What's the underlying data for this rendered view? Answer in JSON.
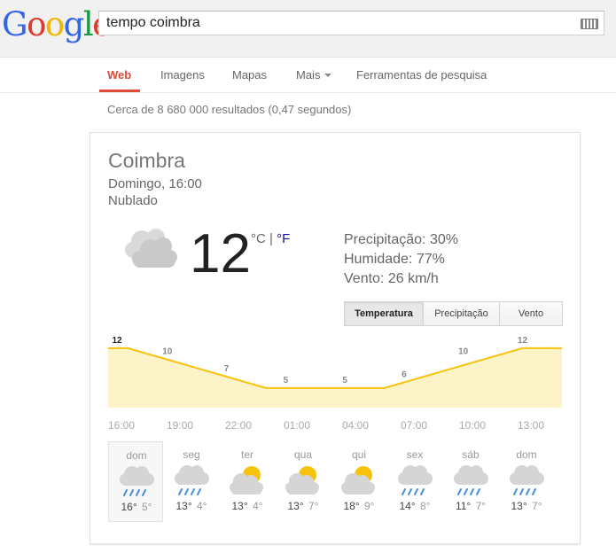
{
  "header": {
    "logo_letters": [
      "G",
      "o",
      "o",
      "g",
      "l",
      "e"
    ],
    "query": "tempo coimbra"
  },
  "tabs": [
    "Web",
    "Imagens",
    "Mapas",
    "Mais",
    "Ferramentas de pesquisa"
  ],
  "stats": "Cerca de 8 680 000 resultados (0,47 segundos)",
  "weather": {
    "city": "Coimbra",
    "datetime": "Domingo, 16:00",
    "condition": "Nublado",
    "icon": "cloudy-icon",
    "temperature": "12",
    "unit_c": "°C",
    "unit_sep": "|",
    "unit_f": "°F",
    "precipitation": "Precipitação: 30%",
    "humidity": "Humidade: 77%",
    "wind": "Vento: 26 km/h",
    "chart_buttons": [
      "Temperatura",
      "Precipitação",
      "Vento"
    ],
    "active_button": "Temperatura",
    "accent_color": "#f6c20c",
    "fill_color": "#fcf3c9"
  },
  "chart_data": {
    "type": "area",
    "x": [
      "16:00",
      "17:00",
      "18:00",
      "19:00",
      "20:00",
      "21:00",
      "22:00",
      "23:00",
      "00:00",
      "01:00",
      "02:00",
      "03:00",
      "04:00",
      "05:00",
      "06:00",
      "07:00",
      "08:00",
      "09:00",
      "10:00",
      "11:00",
      "12:00",
      "13:00",
      "14:00",
      "15:00"
    ],
    "values": [
      12,
      12,
      11,
      10,
      9,
      8,
      7,
      6,
      5,
      5,
      5,
      5,
      5,
      5,
      5,
      6,
      7,
      8,
      9,
      10,
      11,
      12,
      12,
      12
    ],
    "labels": [
      {
        "x": "16:00",
        "value": "12"
      },
      {
        "x": "19:00",
        "value": "10"
      },
      {
        "x": "22:00",
        "value": "7"
      },
      {
        "x": "01:00",
        "value": "5"
      },
      {
        "x": "04:00",
        "value": "5"
      },
      {
        "x": "07:00",
        "value": "6"
      },
      {
        "x": "10:00",
        "value": "10"
      },
      {
        "x": "13:00",
        "value": "12"
      }
    ],
    "tick_labels": [
      "16:00",
      "19:00",
      "22:00",
      "01:00",
      "04:00",
      "07:00",
      "10:00",
      "13:00"
    ],
    "ylim": [
      0,
      14
    ]
  },
  "forecast": [
    {
      "day": "dom",
      "icon": "rain-icon",
      "hi": "16°",
      "lo": "5°"
    },
    {
      "day": "seg",
      "icon": "rain-icon",
      "hi": "13°",
      "lo": "4°"
    },
    {
      "day": "ter",
      "icon": "partly-cloudy-icon",
      "hi": "13°",
      "lo": "4°"
    },
    {
      "day": "qua",
      "icon": "partly-cloudy-icon",
      "hi": "13°",
      "lo": "7°"
    },
    {
      "day": "qui",
      "icon": "partly-cloudy-icon",
      "hi": "18°",
      "lo": "9°"
    },
    {
      "day": "sex",
      "icon": "rain-icon",
      "hi": "14°",
      "lo": "8°"
    },
    {
      "day": "sáb",
      "icon": "rain-icon",
      "hi": "11°",
      "lo": "7°"
    },
    {
      "day": "dom",
      "icon": "rain-icon",
      "hi": "13°",
      "lo": "7°"
    }
  ]
}
